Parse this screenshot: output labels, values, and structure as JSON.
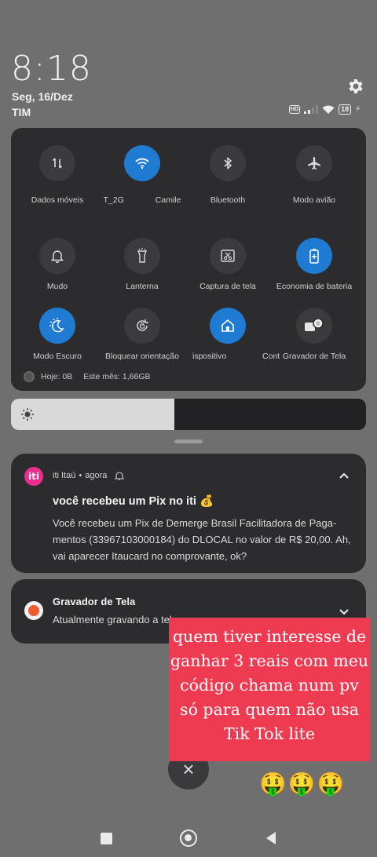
{
  "status": {
    "time": "8:18",
    "date": "Seg, 16/Dez",
    "carrier": "TIM",
    "volte_badge": "HD",
    "battery": "18"
  },
  "quick_settings": {
    "tiles": [
      {
        "label": "Dados móveis",
        "icon": "mobile-data-icon",
        "on": false
      },
      {
        "label": "T_2G",
        "icon": "wifi-icon",
        "on": true
      },
      {
        "label": "Camile",
        "icon": "wifi-network-icon",
        "on": true
      },
      {
        "label": "Bluetooth",
        "icon": "bluetooth-icon",
        "on": false
      },
      {
        "label": "Modo avião",
        "icon": "airplane-icon",
        "on": false
      },
      {
        "label": "Mudo",
        "icon": "bell-icon",
        "on": false
      },
      {
        "label": "Lanterna",
        "icon": "flashlight-icon",
        "on": false
      },
      {
        "label": "Captura de tela",
        "icon": "screenshot-icon",
        "on": false
      },
      {
        "label": "Economia de bateria",
        "icon": "battery-saver-icon",
        "on": true
      },
      {
        "label": "Modo Escuro",
        "icon": "dark-mode-icon",
        "on": true
      },
      {
        "label": "Bloquear orientação",
        "icon": "rotation-lock-icon",
        "on": false
      },
      {
        "label": "ispositivo",
        "icon": "home-device-icon",
        "on": true
      },
      {
        "label": "Cont",
        "icon": "cont-label",
        "on": false
      },
      {
        "label": "Gravador de Tela",
        "icon": "screen-recorder-icon",
        "on": false
      }
    ],
    "data_usage": {
      "today": "Hoje: 0B",
      "month": "Este mês: 1,66GB"
    }
  },
  "brightness": {
    "level": 0.46
  },
  "notifications": [
    {
      "app": "iti Itaú",
      "time": "agora",
      "icon_text": "iti",
      "title": "você recebeu um Pix no iti 💰",
      "body": "Você recebeu um Pix de Demerge Brasil Facilitadora de Paga-mentos (33967103000184) do DLOCAL  no valor de R$ 20,00. Ah, vai aparecer Itaucard no comprovante, ok?"
    },
    {
      "app": "Gravador de Tela",
      "body": "Atualmente gravando a tela"
    }
  ],
  "overlay": {
    "promo_text": "quem tiver interesse de ganhar 3 reais com meu código chama num pv só para quem não usa Tik Tok lite",
    "close": "×",
    "emojis": "🤑🤑🤑"
  },
  "colors": {
    "accent": "#1f7ad1",
    "panel": "#2c2c2e",
    "promo": "#ee3b52",
    "iti": "#ea2d8f"
  }
}
